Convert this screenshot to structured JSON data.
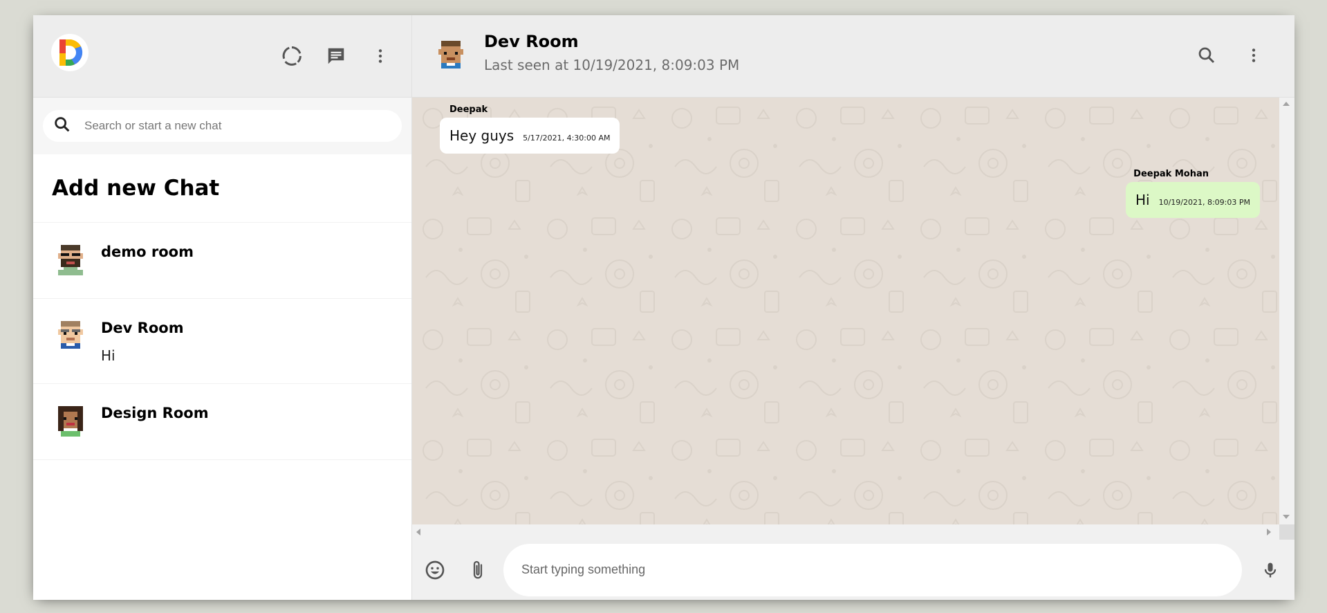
{
  "sidebar": {
    "logo_icon": "app-logo-d",
    "header_icons": [
      "status-icon",
      "chat-icon",
      "more-vert-icon"
    ],
    "search": {
      "placeholder": "Search or start a new chat",
      "value": ""
    },
    "add_chat_label": "Add new Chat",
    "chats": [
      {
        "name": "demo room",
        "last_message": ""
      },
      {
        "name": "Dev Room",
        "last_message": "Hi"
      },
      {
        "name": "Design Room",
        "last_message": ""
      }
    ]
  },
  "chat": {
    "title": "Dev Room",
    "subtitle": "Last seen at 10/19/2021, 8:09:03 PM",
    "header_icons": [
      "search-icon",
      "more-vert-icon"
    ],
    "messages": [
      {
        "name": "Deepak",
        "text": "Hey guys",
        "time": "5/17/2021, 4:30:00 AM",
        "is_sender": false
      },
      {
        "name": "Deepak Mohan",
        "text": "Hi",
        "time": "10/19/2021, 8:09:03 PM",
        "is_sender": true
      }
    ],
    "footer": {
      "placeholder": "Start typing something",
      "value": "",
      "icons": [
        "emoji-icon",
        "attach-icon",
        "mic-icon"
      ]
    }
  },
  "colors": {
    "page_bg": "#dadbd3",
    "header_bg": "#ededed",
    "chat_bg": "#e5ddd5",
    "sent_bubble": "#dcf8c6",
    "received_bubble": "#ffffff"
  }
}
